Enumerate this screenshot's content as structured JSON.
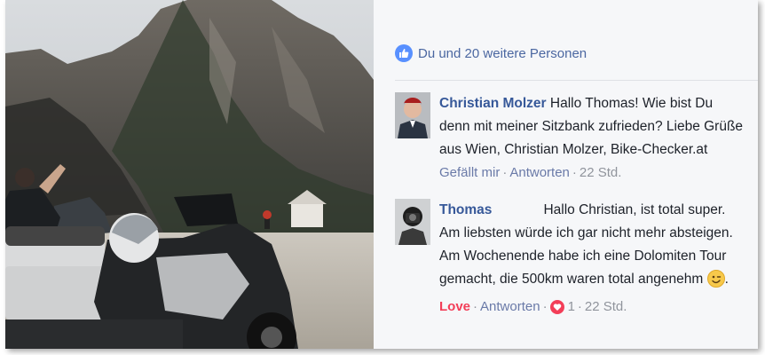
{
  "post": {
    "likes_text": "Du und 20 weitere Personen",
    "like_icon": "thumbs-up-icon"
  },
  "comments": [
    {
      "author": "Christian Molzer",
      "text": "Hallo Thomas! Wie bist Du denn mit meiner Sitzbank zufrieden? Liebe Grüße aus Wien, Christian Molzer, Bike-Checker.at",
      "actions": {
        "like": "Gefällt mir",
        "reply": "Antworten",
        "time": "22 Std."
      }
    },
    {
      "author": "Thomas",
      "text": "Hallo Christian, ist total super. Am liebsten würde ich gar nicht mehr absteigen. Am Wochenende habe ich eine Dolomiten Tour gemacht, die 500km waren total angenehm",
      "text_end": ".",
      "emoji": "winking-face-icon",
      "actions": {
        "like": "Love",
        "reply": "Antworten",
        "reaction_count": "1",
        "time": "22 Std."
      }
    }
  ],
  "colors": {
    "link": "#365899",
    "like_blue": "#5890ff",
    "love_red": "#f33e58",
    "muted": "#90949c"
  }
}
